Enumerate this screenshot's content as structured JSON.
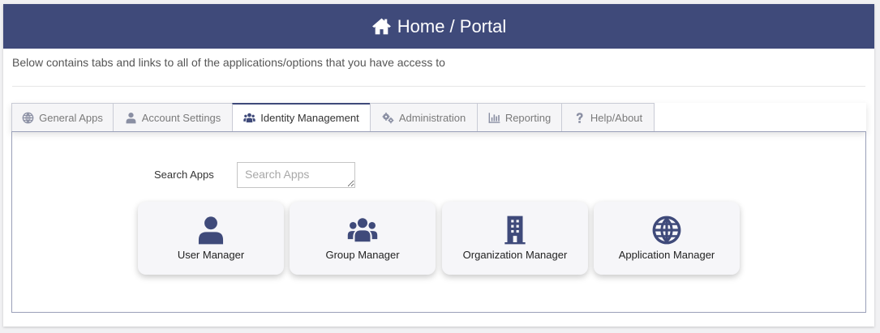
{
  "header": {
    "title": "Home / Portal",
    "icon": "home-icon"
  },
  "intro_text": "Below contains tabs and links to all of the applications/options that you have access to",
  "tabs": [
    {
      "label": "General Apps",
      "icon": "globe-icon"
    },
    {
      "label": "Account Settings",
      "icon": "user-icon"
    },
    {
      "label": "Identity Management",
      "icon": "users-icon",
      "active": true
    },
    {
      "label": "Administration",
      "icon": "gears-icon"
    },
    {
      "label": "Reporting",
      "icon": "chart-icon"
    },
    {
      "label": "Help/About",
      "icon": "question-icon"
    }
  ],
  "search": {
    "label": "Search Apps",
    "placeholder": "Search Apps",
    "value": ""
  },
  "apps": [
    {
      "label": "User Manager",
      "icon": "user-icon"
    },
    {
      "label": "Group Manager",
      "icon": "users-icon"
    },
    {
      "label": "Organization Manager",
      "icon": "building-icon"
    },
    {
      "label": "Application Manager",
      "icon": "globe-icon"
    }
  ],
  "colors": {
    "primary": "#3f4a7a",
    "header_text": "#ffffff",
    "tab_inactive_bg": "#f5f5f7",
    "tile_bg": "#f6f6f9"
  }
}
